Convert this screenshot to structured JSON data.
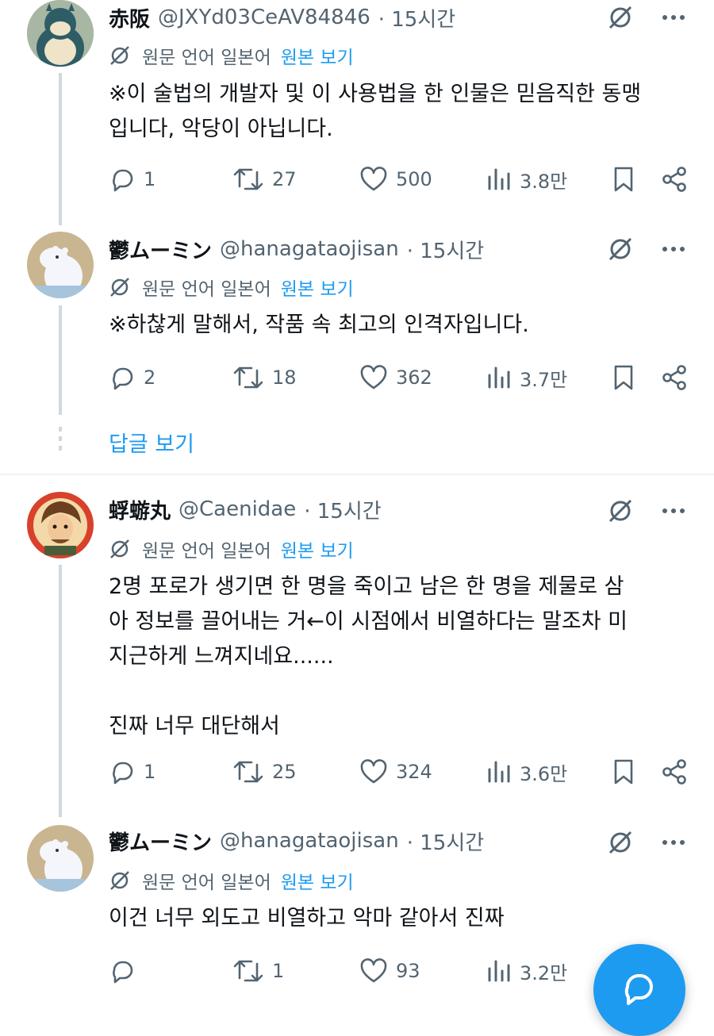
{
  "tweets": [
    {
      "name": "赤阪",
      "handle": "@JXYd03CeAV84846",
      "time": "· 15시간",
      "avatar": "snorlax-plush-avatar",
      "translation": {
        "label": "원문 언어 일본어",
        "link": "원본 보기"
      },
      "text": "※이 술법의 개발자 및 이 사용법을 한 인물은 믿음직한 동맹\n입니다, 악당이 아닙니다.",
      "replies": "1",
      "retweets": "27",
      "likes": "500",
      "views": "3.8만"
    },
    {
      "name": "鬱ムーミン",
      "handle": "@hanagataojisan",
      "time": "· 15시간",
      "avatar": "moomin-plush-avatar",
      "translation": {
        "label": "원문 언어 일본어",
        "link": "원본 보기"
      },
      "text": "※하찮게 말해서, 작품 속 최고의 인격자입니다.",
      "replies": "2",
      "retweets": "18",
      "likes": "362",
      "views": "3.7만"
    },
    {
      "name": "蜉蝣丸",
      "handle": "@Caenidae",
      "time": "· 15시간",
      "avatar": "anime-character-avatar",
      "translation": {
        "label": "원문 언어 일본어",
        "link": "원본 보기"
      },
      "text": "2명 포로가 생기면 한 명을 죽이고 남은 한 명을 제물로 삼\n아 정보를 끌어내는 거←이 시점에서 비열하다는 말조차 미\n지근하게 느껴지네요......\n\n진짜 너무 대단해서",
      "replies": "1",
      "retweets": "25",
      "likes": "324",
      "views": "3.6만"
    },
    {
      "name": "鬱ムーミン",
      "handle": "@hanagataojisan",
      "time": "· 15시간",
      "avatar": "moomin-plush-avatar",
      "translation": {
        "label": "원문 언어 일본어",
        "link": "원본 보기"
      },
      "text": "이건 너무 외도고 비열하고 악마 같아서 진짜",
      "replies": "",
      "retweets": "1",
      "likes": "93",
      "views": "3.2만"
    }
  ],
  "show_replies": "답글 보기",
  "colors": {
    "accent": "#1d9bf0",
    "text": "#0f1419",
    "muted": "#536471",
    "line": "#cfd9de"
  }
}
